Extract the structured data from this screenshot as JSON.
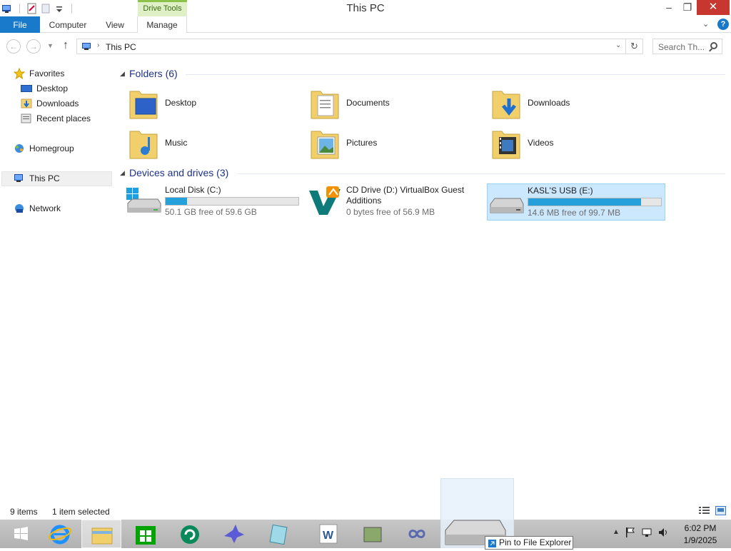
{
  "window": {
    "title": "This PC",
    "contextual_tab": "Drive Tools",
    "controls": {
      "minimize": "–",
      "maximize": "❐",
      "close": "✕"
    }
  },
  "ribbon": {
    "tabs": [
      {
        "label": "File",
        "active": true
      },
      {
        "label": "Computer"
      },
      {
        "label": "View"
      },
      {
        "label": "Manage"
      }
    ]
  },
  "address": {
    "path": "This PC",
    "search_placeholder": "Search Th..."
  },
  "nav": {
    "items": [
      {
        "label": "Favorites",
        "icon": "star-icon"
      },
      {
        "label": "Desktop",
        "icon": "desktop-icon"
      },
      {
        "label": "Downloads",
        "icon": "downloads-icon"
      },
      {
        "label": "Recent places",
        "icon": "recent-places-icon"
      },
      {
        "label": "Homegroup",
        "icon": "homegroup-icon"
      },
      {
        "label": "This PC",
        "icon": "computer-icon",
        "selected": true
      },
      {
        "label": "Network",
        "icon": "network-icon"
      }
    ]
  },
  "folders": {
    "title": "Folders (6)",
    "items": [
      {
        "label": "Desktop",
        "icon": "desktop-folder-icon"
      },
      {
        "label": "Documents",
        "icon": "documents-folder-icon"
      },
      {
        "label": "Downloads",
        "icon": "downloads-folder-icon"
      },
      {
        "label": "Music",
        "icon": "music-folder-icon"
      },
      {
        "label": "Pictures",
        "icon": "pictures-folder-icon"
      },
      {
        "label": "Videos",
        "icon": "videos-folder-icon"
      }
    ]
  },
  "drives": {
    "title": "Devices and drives (3)",
    "items": [
      {
        "name": "Local Disk (C:)",
        "free": "50.1 GB free of 59.6 GB",
        "used_fraction": 0.16,
        "icon": "windows-drive-icon"
      },
      {
        "name": "CD Drive (D:) VirtualBox Guest Additions",
        "free": "0 bytes free of 56.9 MB",
        "icon": "virtualbox-cd-icon"
      },
      {
        "name": "KASL'S USB (E:)",
        "free": "14.6 MB free of 99.7 MB",
        "used_fraction": 0.85,
        "selected": true,
        "icon": "usb-drive-icon"
      }
    ]
  },
  "status": {
    "items": "9 items",
    "selection": "1 item selected"
  },
  "taskbar": {
    "apps": [
      "start-icon",
      "internet-explorer-icon",
      "file-explorer-icon",
      "store-icon",
      "app-icon",
      "bird-app-icon",
      "notepad-app-icon",
      "word-icon",
      "app-icon",
      "infinity-app-icon"
    ],
    "time": "6:02 PM",
    "date": "1/9/2025"
  },
  "tooltip": {
    "pin": "Pin to File Explorer"
  },
  "colors": {
    "accent": "#1979ca",
    "progress": "#26a0da",
    "selection": "#cce8ff",
    "close": "#c7372f",
    "group_title": "#1e3287"
  }
}
